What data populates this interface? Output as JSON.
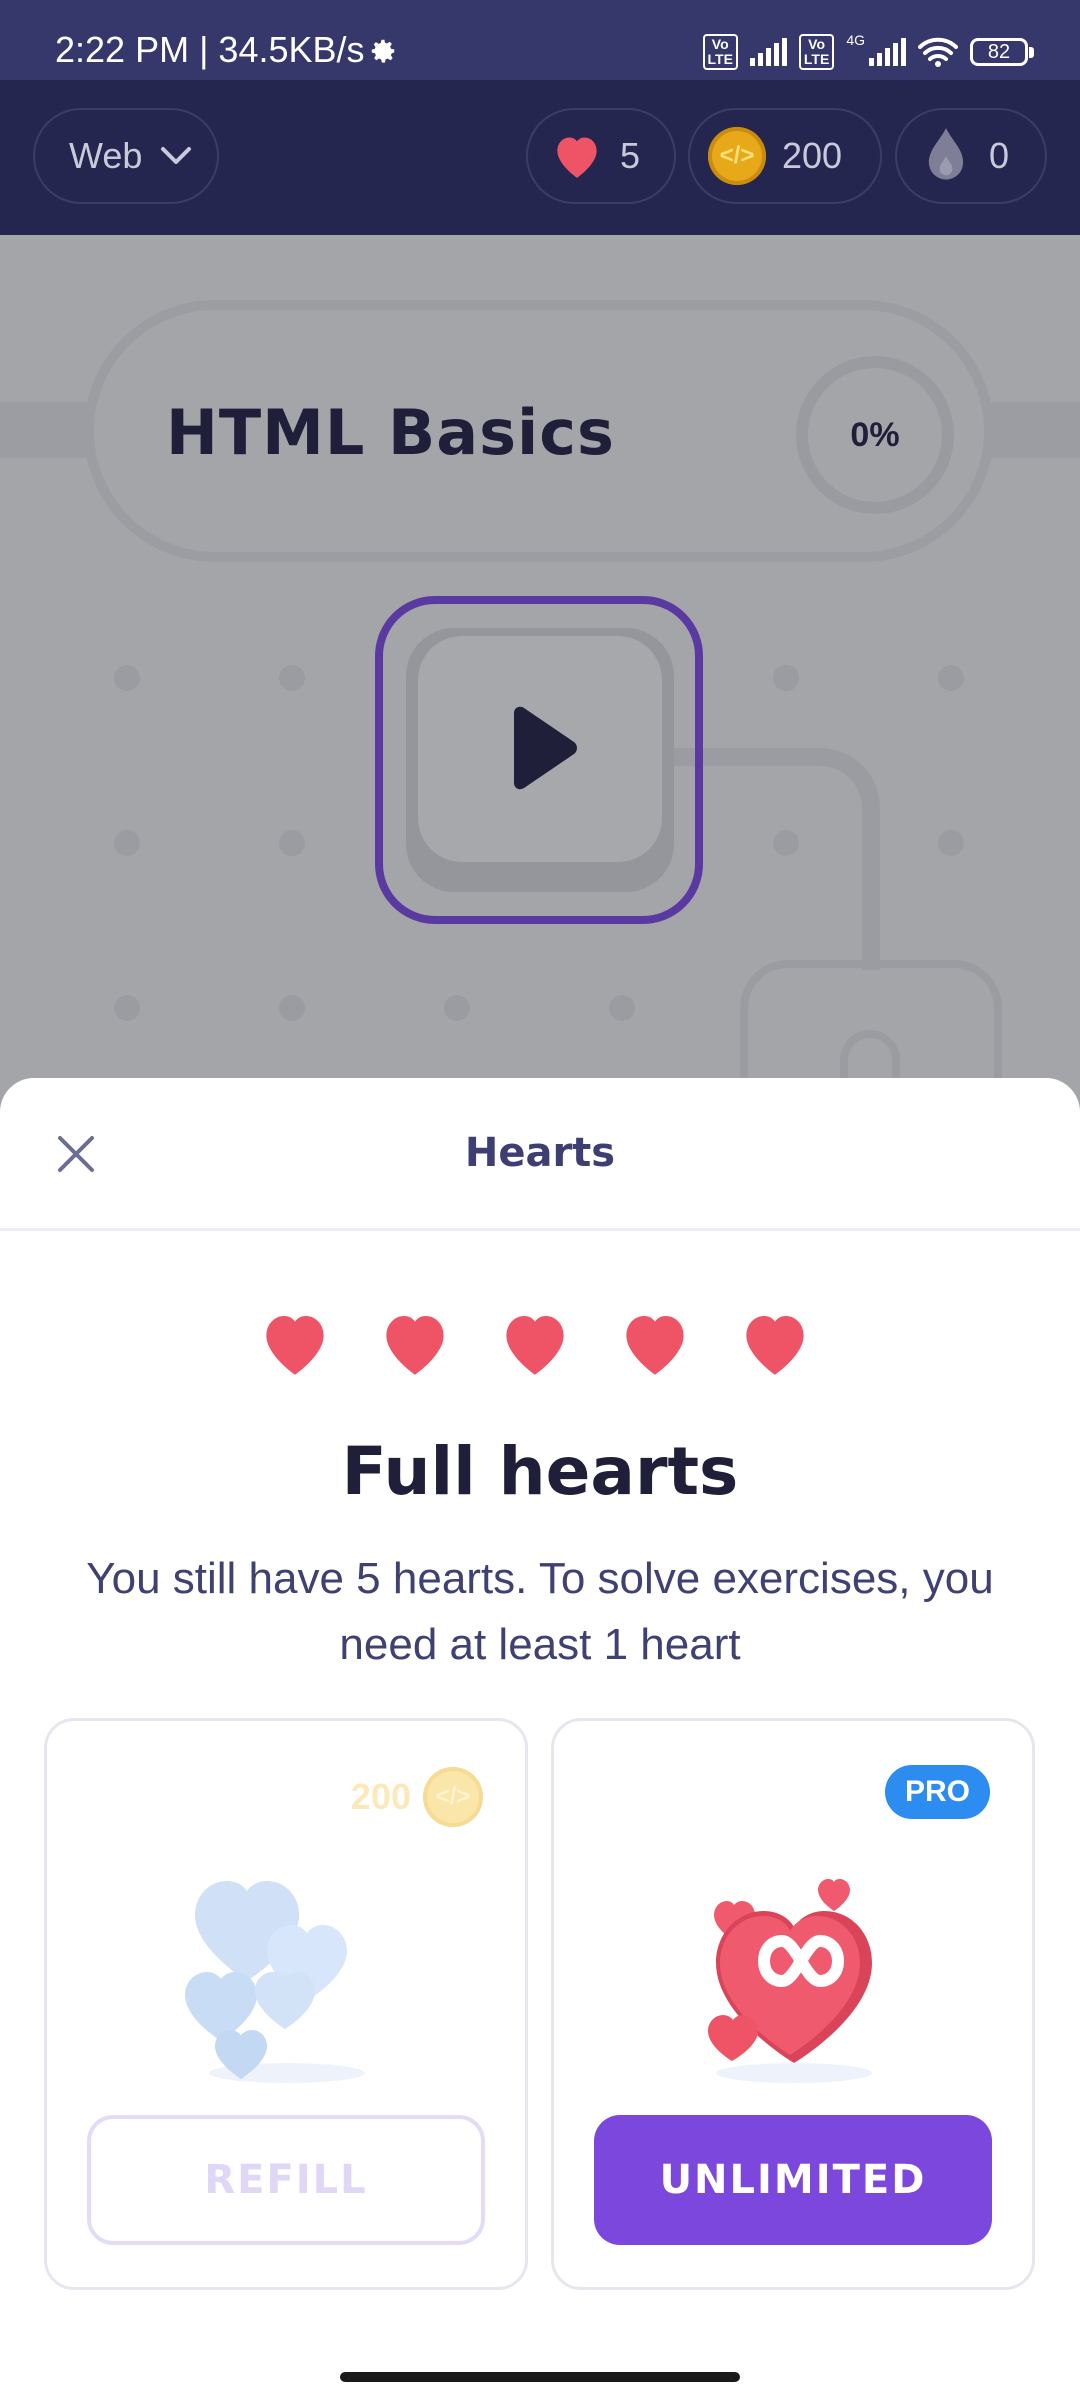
{
  "status_bar": {
    "time_speed": "2:22 PM | 34.5KB/s",
    "volte1": "Vo\nLTE",
    "volte2": "Vo\nLTE",
    "network": "4G",
    "battery": "82"
  },
  "header": {
    "course": "Web",
    "hearts": "5",
    "coins": "200",
    "streak": "0"
  },
  "lesson": {
    "title": "HTML Basics",
    "progress": "0%"
  },
  "sheet": {
    "title": "Hearts",
    "heading": "Full hearts",
    "description": "You still have 5 hearts. To solve exercises, you need at least 1 heart",
    "heart_count": 5,
    "refill": {
      "cost": "200",
      "button": "REFILL"
    },
    "unlimited": {
      "badge": "PRO",
      "button": "UNLIMITED"
    }
  },
  "colors": {
    "accent": "#7b47dc",
    "heart": "#ef5466",
    "pro": "#2d8cf0",
    "header_bg": "#25264f"
  },
  "icons": [
    "gear-icon",
    "signal-icon",
    "wifi-icon",
    "battery-icon",
    "chevron-down-icon",
    "heart-icon",
    "code-coin-icon",
    "streak-drop-icon",
    "play-icon",
    "lock-icon",
    "close-icon",
    "infinity-heart-icon"
  ]
}
